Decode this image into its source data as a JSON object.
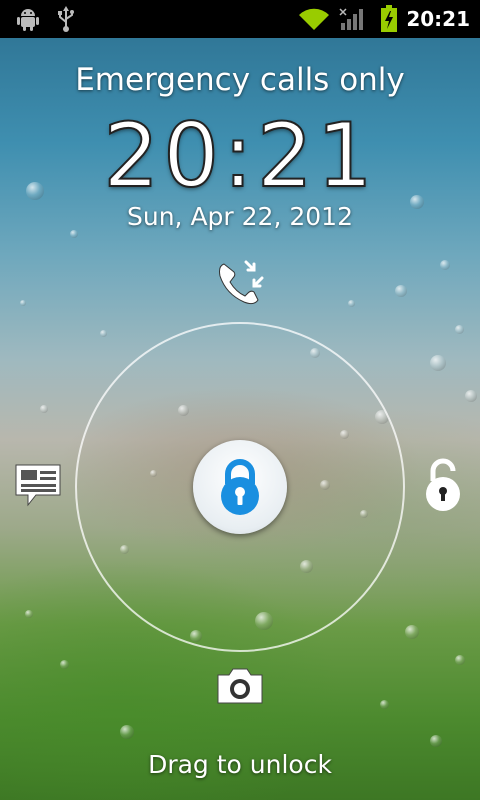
{
  "status_bar": {
    "left_icons": [
      "android-debug-icon",
      "usb-icon"
    ],
    "right_icons": [
      "wifi-icon",
      "signal-icon",
      "battery-charging-icon"
    ],
    "time": "20:21"
  },
  "lockscreen": {
    "carrier_text": "Emergency calls only",
    "clock": "20:21",
    "date": "Sun, Apr 22, 2012",
    "hint": "Drag to unlock",
    "targets": [
      "missed-call-icon",
      "message-icon",
      "unlock-icon",
      "camera-icon"
    ],
    "center_handle": "lock-icon"
  },
  "colors": {
    "status_bar_bg": "#000000",
    "wifi_green": "#99cc00",
    "lock_blue": "#1a8fe0",
    "ring": "#ffffff"
  }
}
